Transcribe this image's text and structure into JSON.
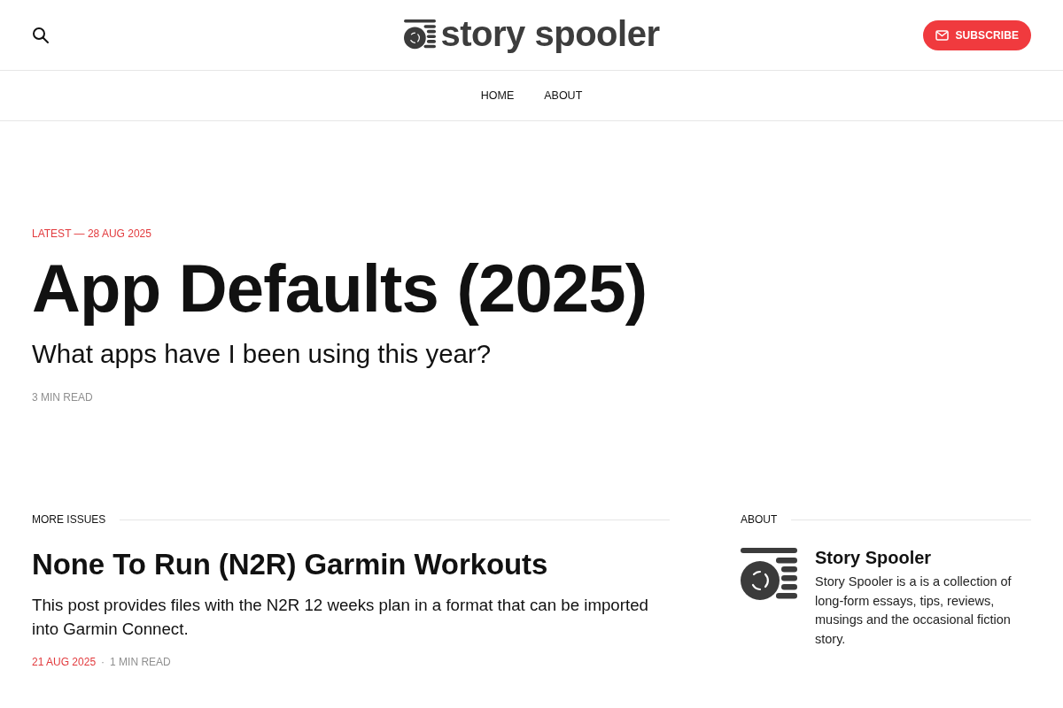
{
  "header": {
    "logo_text": "story spooler",
    "subscribe_label": "SUBSCRIBE"
  },
  "nav": [
    {
      "label": "HOME"
    },
    {
      "label": "ABOUT"
    }
  ],
  "featured": {
    "label": "LATEST — 28 AUG 2025",
    "title": "App Defaults (2025)",
    "subtitle": "What apps have I been using this year?",
    "reading_time": "3 MIN READ"
  },
  "more_issues": {
    "heading": "MORE ISSUES",
    "posts": [
      {
        "title": "None To Run (N2R) Garmin Workouts",
        "excerpt": "This post provides files with the N2R 12 weeks plan in a format that can be imported into Garmin Connect.",
        "date": "21 AUG 2025",
        "separator": "·",
        "reading_time": "1 MIN READ"
      }
    ]
  },
  "about": {
    "heading": "ABOUT",
    "title": "Story Spooler",
    "description": "Story Spooler is a is a collection of long-form essays, tips, reviews, musings and the occasional fiction story."
  }
}
